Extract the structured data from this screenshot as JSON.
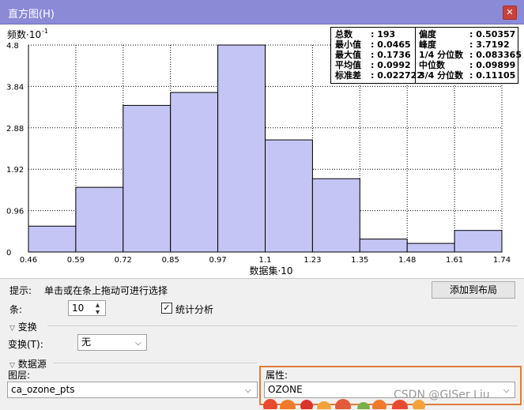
{
  "window": {
    "title": "直方图(H)",
    "close_label": "✕"
  },
  "chart_data": {
    "type": "bar",
    "ylabel": "频数",
    "ylabel_exp": "-1",
    "xlabel": "数据集",
    "x_ticks": [
      "0.46",
      "0.59",
      "0.72",
      "0.85",
      "0.97",
      "1.1",
      "1.23",
      "1.35",
      "1.48",
      "1.61",
      "1.74"
    ],
    "y_ticks": [
      "0",
      "0.96",
      "1.92",
      "2.88",
      "3.84",
      "4.8"
    ],
    "ylim": [
      0,
      4.8
    ],
    "values": [
      0.6,
      1.5,
      3.4,
      3.7,
      4.8,
      2.6,
      1.7,
      0.3,
      0.2,
      0.5
    ],
    "bar_color": "#c5c5f5",
    "grid": true
  },
  "stats": {
    "left": [
      {
        "label": "总数",
        "value": ": 193"
      },
      {
        "label": "最小值",
        "value": ": 0.0465"
      },
      {
        "label": "最大值",
        "value": ": 0.1736"
      },
      {
        "label": "平均值",
        "value": ": 0.0992"
      },
      {
        "label": "标准差",
        "value": ": 0.022722"
      }
    ],
    "right": [
      {
        "label": "偏度",
        "value": ": 0.50357"
      },
      {
        "label": "峰度",
        "value": ": 3.7192"
      },
      {
        "label": "1/4 分位数",
        "value": ": 0.083365"
      },
      {
        "label": "中位数",
        "value": ": 0.09899"
      },
      {
        "label": "3/4 分位数",
        "value": ": 0.11105"
      }
    ]
  },
  "controls": {
    "hint_label": "提示:",
    "hint_text": "单击或在条上拖动可进行选择",
    "add_to_layout": "添加到布局",
    "bins_label": "条:",
    "bins_value": "10",
    "stats_label": "统计分析",
    "stats_checked": "✓"
  },
  "transform": {
    "section": "变换",
    "label": "变换(T):",
    "value": "无"
  },
  "datasource": {
    "section": "数据源",
    "layer_label": "图层:",
    "layer_value": "ca_ozone_pts",
    "attr_label": "属性:",
    "attr_value": "OZONE"
  },
  "watermark": "CSDN @GISer Liu"
}
